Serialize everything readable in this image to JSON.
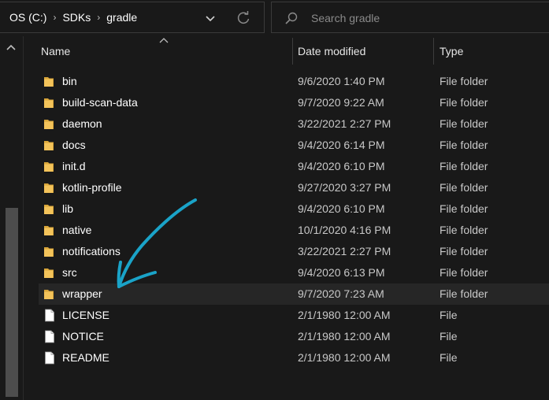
{
  "address_bar": {
    "breadcrumbs": [
      {
        "label": "OS (C:)"
      },
      {
        "label": "SDKs"
      },
      {
        "label": "gradle"
      }
    ],
    "separator_glyph": "›",
    "dropdown_icon": "chevron-down-icon",
    "refresh_icon": "refresh-icon"
  },
  "search": {
    "placeholder": "Search gradle",
    "value": "",
    "icon": "search-icon"
  },
  "columns": {
    "name": "Name",
    "date": "Date modified",
    "type": "Type",
    "sorted_by": "Name"
  },
  "files": [
    {
      "name": "bin",
      "date": "9/6/2020 1:40 PM",
      "type": "File folder",
      "icon": "folder-icon"
    },
    {
      "name": "build-scan-data",
      "date": "9/7/2020 9:22 AM",
      "type": "File folder",
      "icon": "folder-icon"
    },
    {
      "name": "daemon",
      "date": "3/22/2021 2:27 PM",
      "type": "File folder",
      "icon": "folder-icon"
    },
    {
      "name": "docs",
      "date": "9/4/2020 6:14 PM",
      "type": "File folder",
      "icon": "folder-icon"
    },
    {
      "name": "init.d",
      "date": "9/4/2020 6:10 PM",
      "type": "File folder",
      "icon": "folder-icon"
    },
    {
      "name": "kotlin-profile",
      "date": "9/27/2020 3:27 PM",
      "type": "File folder",
      "icon": "folder-icon"
    },
    {
      "name": "lib",
      "date": "9/4/2020 6:10 PM",
      "type": "File folder",
      "icon": "folder-icon"
    },
    {
      "name": "native",
      "date": "10/1/2020 4:16 PM",
      "type": "File folder",
      "icon": "folder-icon"
    },
    {
      "name": "notifications",
      "date": "3/22/2021 2:27 PM",
      "type": "File folder",
      "icon": "folder-icon"
    },
    {
      "name": "src",
      "date": "9/4/2020 6:13 PM",
      "type": "File folder",
      "icon": "folder-icon"
    },
    {
      "name": "wrapper",
      "date": "9/7/2020 7:23 AM",
      "type": "File folder",
      "icon": "folder-icon",
      "highlighted": true
    },
    {
      "name": "LICENSE",
      "date": "2/1/1980 12:00 AM",
      "type": "File",
      "icon": "file-icon"
    },
    {
      "name": "NOTICE",
      "date": "2/1/1980 12:00 AM",
      "type": "File",
      "icon": "file-icon"
    },
    {
      "name": "README",
      "date": "2/1/1980 12:00 AM",
      "type": "File",
      "icon": "file-icon"
    }
  ],
  "colors": {
    "background": "#191919",
    "text": "#ffffff",
    "secondary_text": "#c8c8c8",
    "row_highlight": "#262626",
    "folder": "#f3c35a",
    "annotation_arrow": "#1aa3c8"
  }
}
